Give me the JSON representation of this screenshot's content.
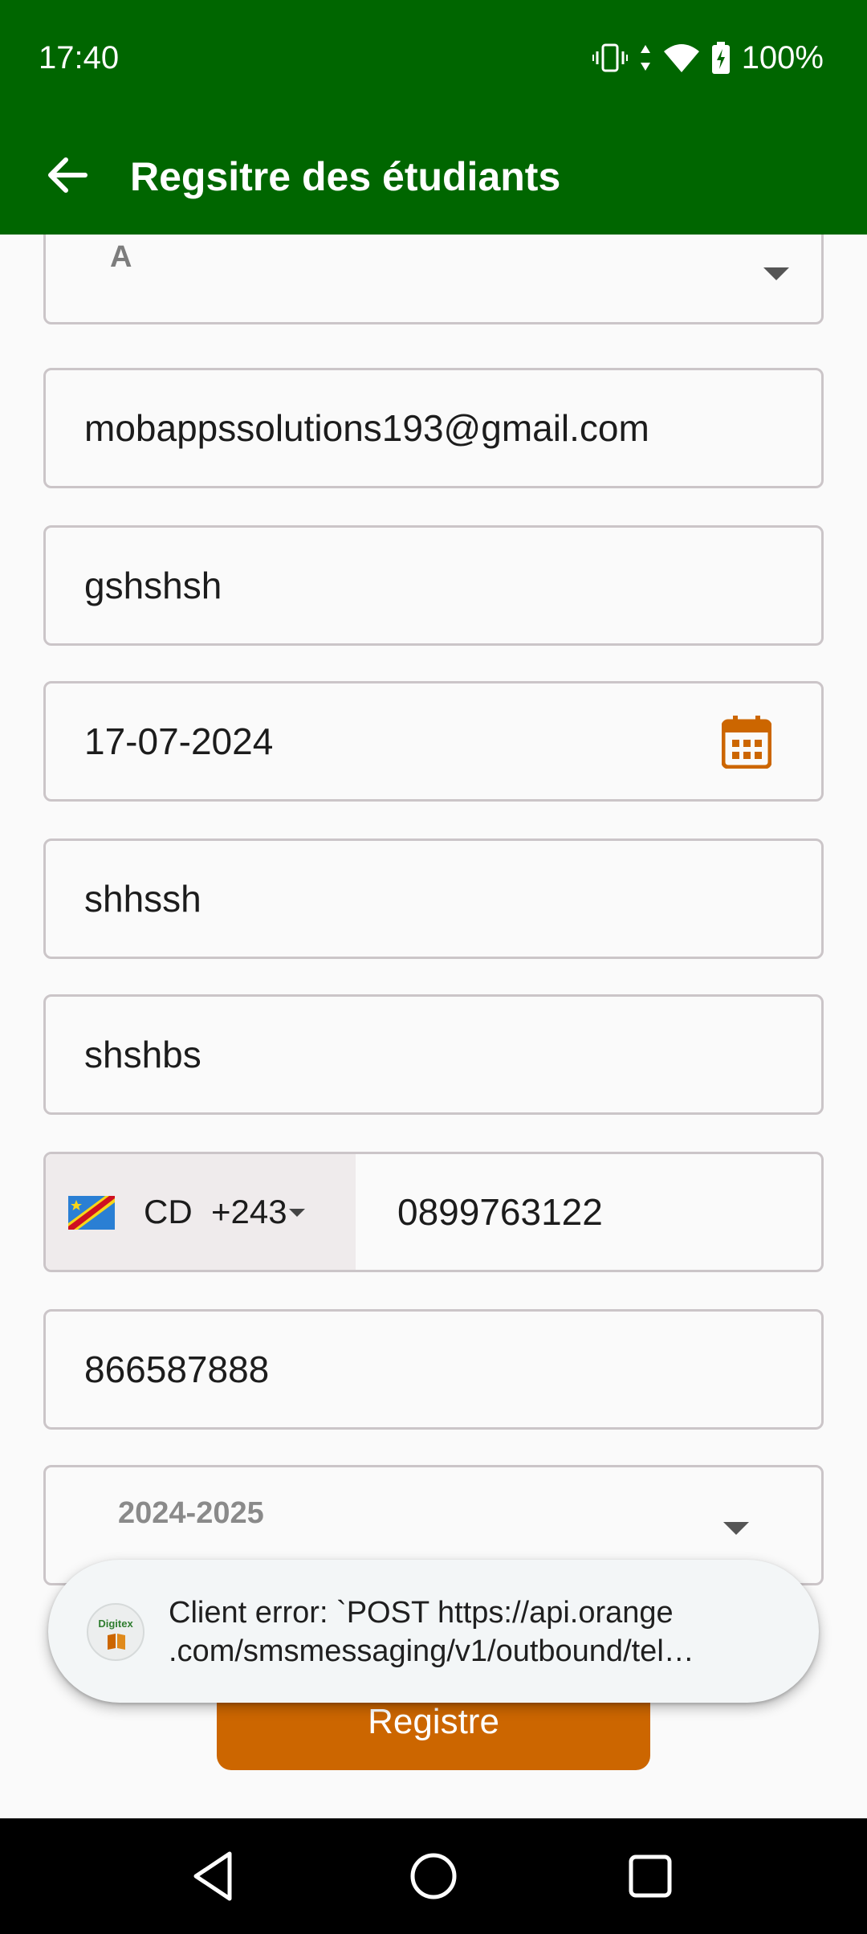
{
  "status_bar": {
    "time": "17:40",
    "battery": "100%",
    "icons": [
      "vibrate-icon",
      "data-arrows-icon",
      "wifi-icon",
      "battery-charging-icon"
    ]
  },
  "app_bar": {
    "title": "Regsitre des étudiants",
    "back_icon": "arrow-left-icon"
  },
  "form": {
    "section_dropdown": {
      "value": "A"
    },
    "email": {
      "value": "mobappssolutions193@gmail.com"
    },
    "field_2": {
      "value": "gshshsh"
    },
    "birth_date": {
      "value": "17-07-2024",
      "icon": "calendar-icon"
    },
    "field_4": {
      "value": "shhssh"
    },
    "field_5": {
      "value": "shshbs"
    },
    "phone": {
      "country_code": "CD",
      "dial_code": "+243",
      "number": "0899763122",
      "flag_icon": "drc-flag-icon"
    },
    "field_7": {
      "value": "866587888"
    },
    "academic_year_dropdown": {
      "value": "2024-2025"
    },
    "submit_label": "Registre"
  },
  "toast": {
    "line1": "Client error: `POST https://api.orange",
    "line2": ".com/smsmessaging/v1/outbound/tel…",
    "logo_text": "Digitex"
  },
  "colors": {
    "primary": "#006600",
    "accent": "#cc6600",
    "background": "#fafafa",
    "border": "#cbc5c8"
  },
  "nav_bar": {
    "buttons": [
      "back-triangle-icon",
      "home-circle-icon",
      "recents-square-icon"
    ]
  }
}
